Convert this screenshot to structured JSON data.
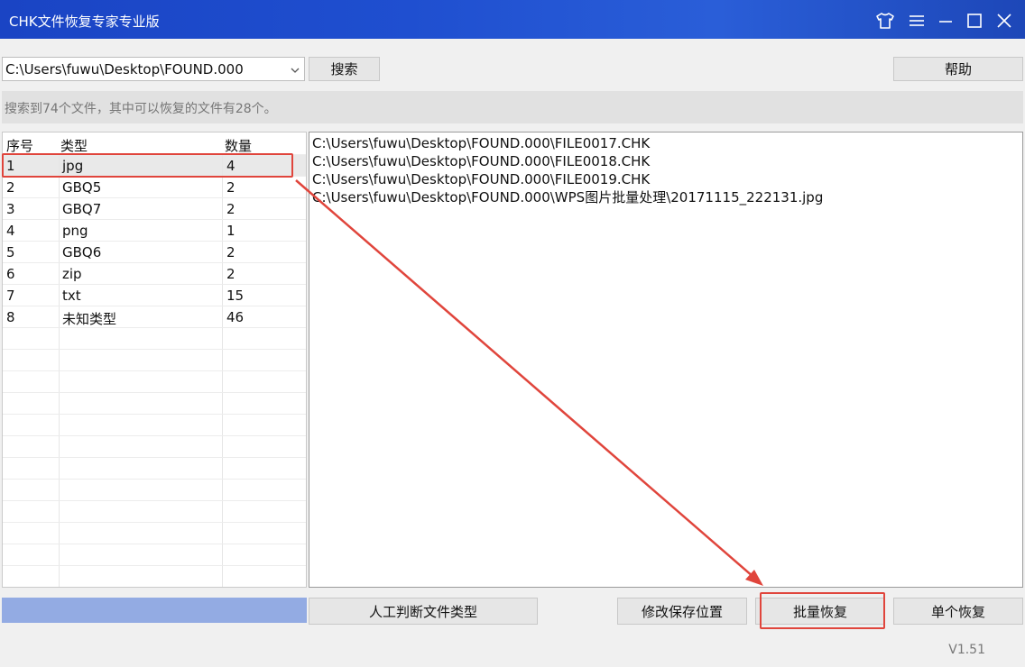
{
  "window": {
    "title": "CHK文件恢复专家专业版",
    "controls": [
      "skin-icon",
      "menu-icon",
      "minimize-icon",
      "maximize-icon",
      "close-icon"
    ]
  },
  "toolbar": {
    "path_value": "C:\\Users\\fuwu\\Desktop\\FOUND.000",
    "search_label": "搜索",
    "help_label": "帮助"
  },
  "status": {
    "text": "搜索到74个文件，其中可以恢复的文件有28个。"
  },
  "type_table": {
    "headers": [
      "序号",
      "类型",
      "数量"
    ],
    "rows": [
      [
        "1",
        "jpg",
        "4"
      ],
      [
        "2",
        "GBQ5",
        "2"
      ],
      [
        "3",
        "GBQ7",
        "2"
      ],
      [
        "4",
        "png",
        "1"
      ],
      [
        "5",
        "GBQ6",
        "2"
      ],
      [
        "6",
        "zip",
        "2"
      ],
      [
        "7",
        "txt",
        "15"
      ],
      [
        "8",
        "未知类型",
        "46"
      ]
    ],
    "selected_index": 0
  },
  "file_list": {
    "items": [
      "C:\\Users\\fuwu\\Desktop\\FOUND.000\\FILE0017.CHK",
      "C:\\Users\\fuwu\\Desktop\\FOUND.000\\FILE0018.CHK",
      "C:\\Users\\fuwu\\Desktop\\FOUND.000\\FILE0019.CHK",
      "C:\\Users\\fuwu\\Desktop\\FOUND.000\\WPS图片批量处理\\20171115_222131.jpg"
    ]
  },
  "actions": {
    "manual_type_label": "人工判断文件类型",
    "change_save_label": "修改保存位置",
    "batch_recover_label": "批量恢复",
    "single_recover_label": "单个恢复"
  },
  "footer": {
    "version": "V1.51"
  },
  "colors": {
    "titlebar": "#1f4fd0",
    "progress": "#93abe3",
    "annotation": "#e0453c"
  }
}
